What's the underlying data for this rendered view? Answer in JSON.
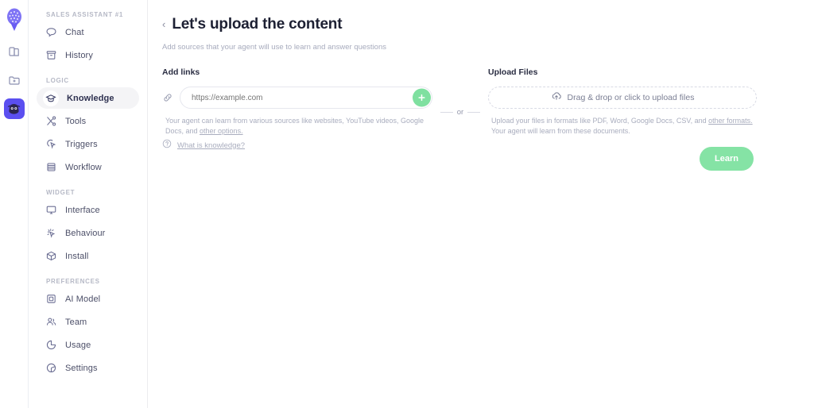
{
  "colors": {
    "accent_purple": "#5b4ff0",
    "accent_green": "#85e3a5",
    "add_button_green": "#7fe0a0",
    "text_dark": "#1d2033",
    "text_muted": "#a9adbe",
    "nav_text": "#4c4f68",
    "active_pill": "#f4f4f6"
  },
  "rail": {
    "logo_name": "pineapple-logo",
    "items": [
      {
        "name": "library-icon",
        "active": false
      },
      {
        "name": "new-folder-icon",
        "active": false
      },
      {
        "name": "agent-avatar-icon",
        "active": true
      }
    ]
  },
  "sidebar": {
    "groups": [
      {
        "label": "SALES ASSISTANT #1",
        "items": [
          {
            "label": "Chat",
            "icon": "chat-bubble-icon",
            "active": false
          },
          {
            "label": "History",
            "icon": "archive-box-icon",
            "active": false
          }
        ]
      },
      {
        "label": "LOGIC",
        "items": [
          {
            "label": "Knowledge",
            "icon": "graduation-cap-icon",
            "active": true
          },
          {
            "label": "Tools",
            "icon": "tools-icon",
            "active": false
          },
          {
            "label": "Triggers",
            "icon": "trigger-click-icon",
            "active": false
          },
          {
            "label": "Workflow",
            "icon": "workflow-stack-icon",
            "active": false
          }
        ]
      },
      {
        "label": "WIDGET",
        "items": [
          {
            "label": "Interface",
            "icon": "monitor-icon",
            "active": false
          },
          {
            "label": "Behaviour",
            "icon": "sparkle-cursor-icon",
            "active": false
          },
          {
            "label": "Install",
            "icon": "cube-icon",
            "active": false
          }
        ]
      },
      {
        "label": "PREFERENCES",
        "items": [
          {
            "label": "AI Model",
            "icon": "chip-icon",
            "active": false
          },
          {
            "label": "Team",
            "icon": "users-icon",
            "active": false
          },
          {
            "label": "Usage",
            "icon": "pie-chart-icon",
            "active": false
          },
          {
            "label": "Settings",
            "icon": "settings-dial-icon",
            "active": false
          }
        ]
      }
    ]
  },
  "header": {
    "back_label": "‹",
    "title": "Let's upload the content",
    "subtitle": "Add sources that your agent will use to learn and answer questions"
  },
  "links_section": {
    "title": "Add links",
    "link_icon": "link-chain-icon",
    "input_placeholder": "https://example.com",
    "input_value": "",
    "add_button_label": "+",
    "helper_text": "Your agent can learn from various sources like websites, YouTube videos, Google Docs, and ",
    "helper_link": "other options."
  },
  "divider": {
    "or_label": "or"
  },
  "upload_section": {
    "title": "Upload Files",
    "dropzone_icon": "cloud-upload-icon",
    "dropzone_label": "Drag & drop or click to upload files",
    "helper_text_before": "Upload your files in formats like PDF, Word, Google Docs, CSV, and ",
    "helper_link": "other formats.",
    "helper_text_after": " Your agent will learn from these documents."
  },
  "footer": {
    "help_icon": "question-circle-icon",
    "help_label": "What is knowledge?",
    "learn_button_label": "Learn"
  }
}
